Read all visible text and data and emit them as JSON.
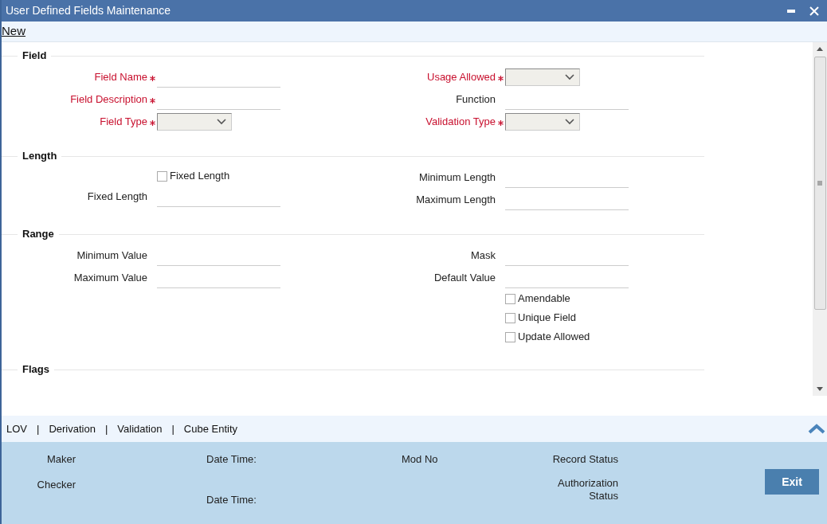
{
  "window": {
    "title": "User Defined Fields Maintenance"
  },
  "toolbar": {
    "link": "New"
  },
  "sections": [
    {
      "title": "Field",
      "left": [
        {
          "kind": "text",
          "label": "Field Name",
          "required": true
        },
        {
          "kind": "text",
          "label": "Field Description",
          "required": true
        },
        {
          "kind": "select",
          "label": "Field Type",
          "required": true
        }
      ],
      "right": [
        {
          "kind": "select",
          "label": "Usage Allowed",
          "required": true
        },
        {
          "kind": "text",
          "label": "Function",
          "required": false
        },
        {
          "kind": "select",
          "label": "Validation Type",
          "required": true
        }
      ]
    },
    {
      "title": "Length",
      "left": [
        {
          "kind": "checkbox",
          "label": "Fixed Length",
          "checked": false
        },
        {
          "kind": "text",
          "label": "Fixed Length",
          "required": false
        }
      ],
      "right": [
        {
          "kind": "text",
          "label": "Minimum Length",
          "required": false
        },
        {
          "kind": "text",
          "label": "Maximum Length",
          "required": false
        }
      ]
    },
    {
      "title": "Range",
      "left": [
        {
          "kind": "text",
          "label": "Minimum Value",
          "required": false
        },
        {
          "kind": "text",
          "label": "Maximum Value",
          "required": false
        }
      ],
      "right": [
        {
          "kind": "text",
          "label": "Mask",
          "required": false
        },
        {
          "kind": "text",
          "label": "Default Value",
          "required": false
        },
        {
          "kind": "checkbox",
          "label": "Amendable",
          "checked": false
        },
        {
          "kind": "checkbox",
          "label": "Unique Field",
          "checked": false
        },
        {
          "kind": "checkbox",
          "label": "Update Allowed",
          "checked": false
        }
      ]
    },
    {
      "title": "Flags"
    }
  ],
  "tabs": {
    "separator": "|",
    "items": [
      {
        "label": "LOV"
      },
      {
        "label": "Derivation"
      },
      {
        "label": "Validation"
      },
      {
        "label": "Cube Entity"
      }
    ]
  },
  "audit": {
    "maker": "Maker",
    "checker": "Checker",
    "date_time_1": "Date Time:",
    "date_time_2": "Date Time:",
    "mod_no": "Mod No",
    "record_status": "Record Status",
    "authorization_status": "Authorization Status"
  },
  "exit_button": "Exit"
}
